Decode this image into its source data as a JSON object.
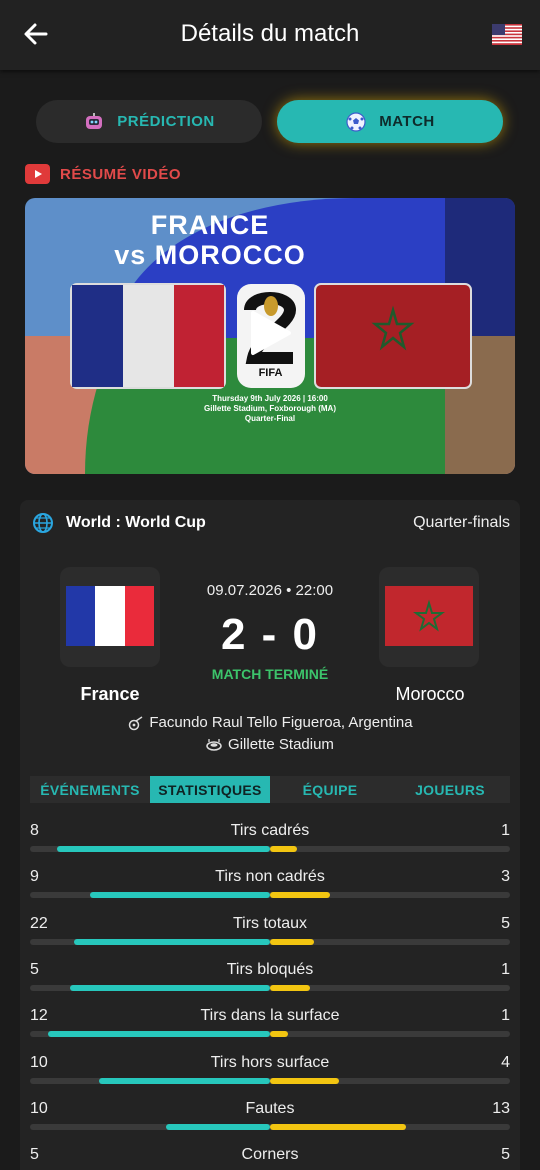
{
  "header": {
    "title": "Détails du match",
    "back_icon": "arrow-left-icon",
    "flag_icon": "us-flag-icon"
  },
  "segments": {
    "prediction_label": "PRÉDICTION",
    "match_label": "MATCH",
    "accent": "#27b8b2",
    "active": "match"
  },
  "resume": {
    "label": "RÉSUMÉ VIDÉO",
    "icon": "youtube-icon",
    "color": "#e14a4a"
  },
  "video": {
    "title_line1": "FRANCE",
    "title_line2": "vs MOROCCO",
    "fifa_label": "FIFA",
    "date_line": "Thursday 9th July 2026 | 16:00",
    "venue_line": "Gillette Stadium, Foxborough (MA)",
    "round_line": "Quarter-Final"
  },
  "match": {
    "competition": "World : World Cup",
    "stage": "Quarter-finals",
    "datetime": "09.07.2026 • 22:00",
    "score": "2 - 0",
    "status": "MATCH TERMINÉ",
    "home_team": "France",
    "away_team": "Morocco",
    "referee": "Facundo Raul Tello Figueroa, Argentina",
    "stadium": "Gillette Stadium"
  },
  "tabs": [
    {
      "label": "ÉVÉNEMENTS"
    },
    {
      "label": "STATISTIQUES"
    },
    {
      "label": "ÉQUIPE"
    },
    {
      "label": "JOUEURS"
    }
  ],
  "stats": [
    {
      "label": "Tirs cadrés",
      "home": "8",
      "away": "1"
    },
    {
      "label": "Tirs non cadrés",
      "home": "9",
      "away": "3"
    },
    {
      "label": "Tirs totaux",
      "home": "22",
      "away": "5"
    },
    {
      "label": "Tirs bloqués",
      "home": "5",
      "away": "1"
    },
    {
      "label": "Tirs dans la surface",
      "home": "12",
      "away": "1"
    },
    {
      "label": "Tirs hors surface",
      "home": "10",
      "away": "4"
    },
    {
      "label": "Fautes",
      "home": "10",
      "away": "13"
    },
    {
      "label": "Corners",
      "home": "5",
      "away": "5"
    }
  ],
  "colors": {
    "home_bar": "#27c7bc",
    "away_bar": "#f2c511",
    "status": "#3cc46b"
  }
}
